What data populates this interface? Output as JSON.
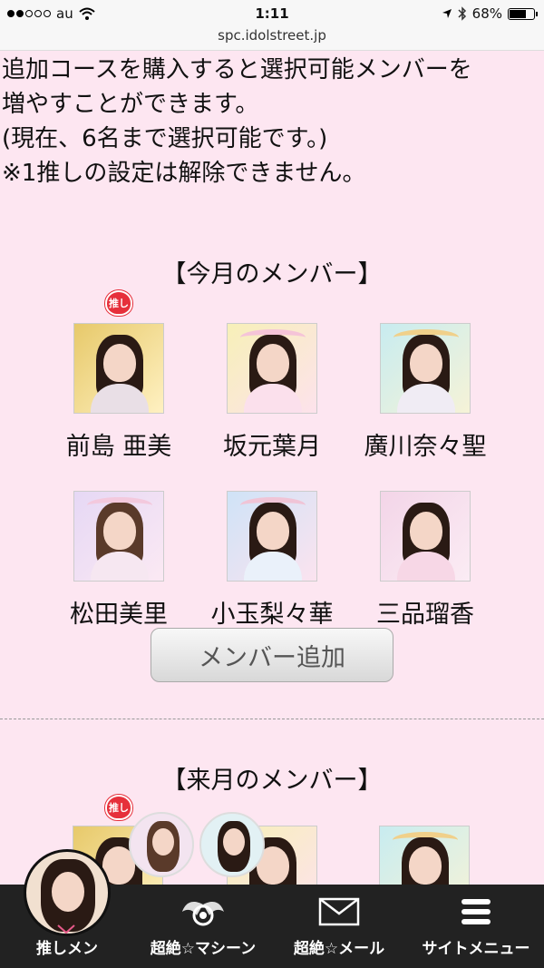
{
  "status_bar": {
    "carrier": "au",
    "time": "1:11",
    "battery": "68%",
    "battery_level": 0.68,
    "url": "spc.idolstreet.jp"
  },
  "intro": {
    "line1": "追加コースを購入すると選択可能メンバーを",
    "line2": "増やすことができます。",
    "line3": "(現在、6名まで選択可能です。)",
    "line4": "※1推しの設定は解除できません。"
  },
  "this_month": {
    "title": "【今月のメンバー】",
    "oshi_badge": "推し",
    "members": [
      {
        "name": "前島 亜美"
      },
      {
        "name": "坂元葉月"
      },
      {
        "name": "廣川奈々聖"
      },
      {
        "name": "松田美里"
      },
      {
        "name": "小玉梨々華"
      },
      {
        "name": "三品瑠香"
      }
    ],
    "add_button": "メンバー追加"
  },
  "next_month": {
    "title": "【来月のメンバー】",
    "oshi_badge": "推し"
  },
  "tabbar": {
    "items": [
      {
        "label": "推しメン"
      },
      {
        "label": "超絶☆マシーン"
      },
      {
        "label": "超絶☆メール"
      },
      {
        "label": "サイトメニュー"
      }
    ]
  },
  "colors": {
    "background": "#fde6f1",
    "heart": "#e6303b",
    "tabbar": "#222222"
  }
}
